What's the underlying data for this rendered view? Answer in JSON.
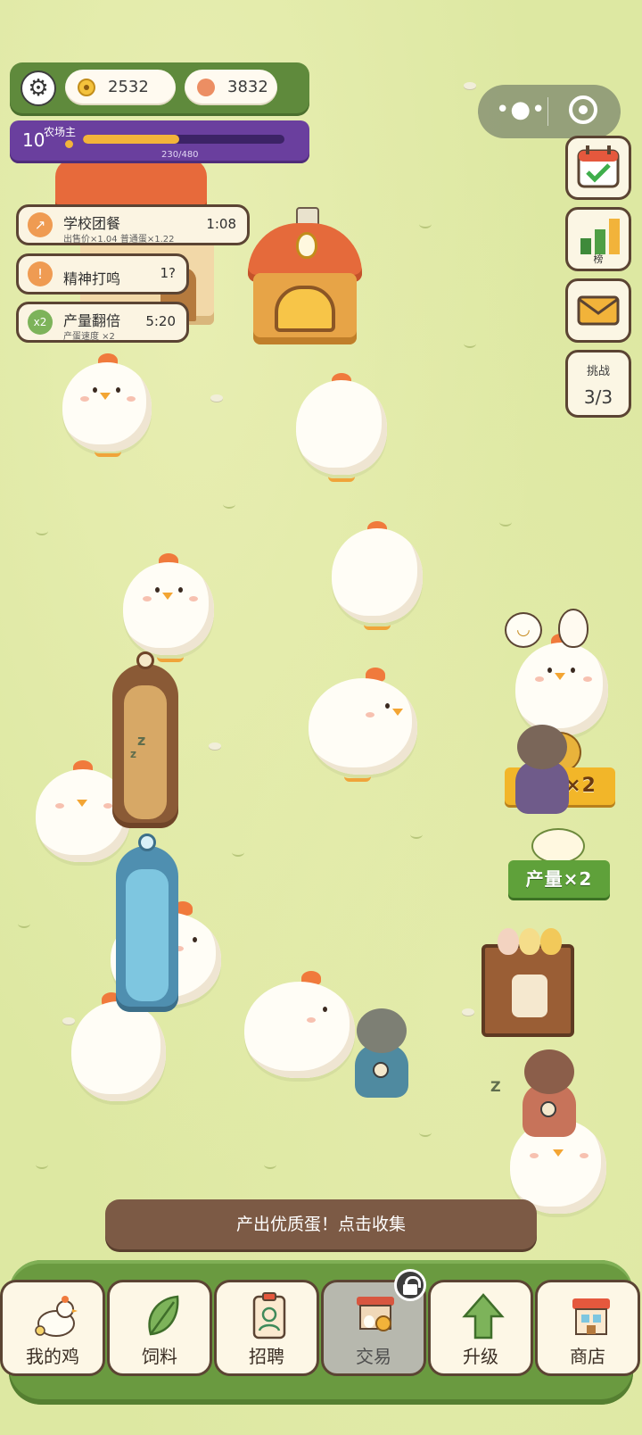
{
  "currency": {
    "coins": "2532",
    "gems": "3832",
    "coin_icon": "gold-coin-icon",
    "gem_icon": "orange-gem-icon"
  },
  "level": {
    "number": "10",
    "title": "农场主",
    "progress_text": "230/480",
    "progress_fraction": 0.479
  },
  "buffs": [
    {
      "icon": "arrow-up-icon",
      "glyph": "↗",
      "name": "学校团餐",
      "detail": "出售价×1.04 普通蛋×1.22",
      "time": "1:08",
      "color": "#ef9b52"
    },
    {
      "icon": "exclamation-icon",
      "glyph": "!",
      "name": "精神打鸣",
      "detail": "",
      "time": "1?",
      "color": "#ef9b52"
    },
    {
      "icon": "x2-icon",
      "glyph": "x2",
      "name": "产量翻倍",
      "detail": "产蛋速度 ×2",
      "time": "5:20",
      "color": "#7db35a"
    }
  ],
  "side": {
    "rank_label": "榜",
    "challenge_title": "挑战",
    "challenge_value": "3/3"
  },
  "boosts": {
    "income": "收益×2",
    "output": "产量×2"
  },
  "toast": "产出优质蛋！点击收集",
  "nav": [
    {
      "label": "我的鸡",
      "icon": "chicken-icon"
    },
    {
      "label": "饲料",
      "icon": "leaf-icon"
    },
    {
      "label": "招聘",
      "icon": "id-badge-icon"
    },
    {
      "label": "交易",
      "icon": "market-stall-icon",
      "locked": true
    },
    {
      "label": "升级",
      "icon": "up-arrow-icon"
    },
    {
      "label": "商店",
      "icon": "shop-icon"
    }
  ],
  "colors": {
    "grass": "#dde8a2",
    "top_bar": "#5f8a3c",
    "level_bar": "#6a3f9e",
    "nav_panel": "#6a9a40",
    "toast_bg": "#7c5a45"
  }
}
